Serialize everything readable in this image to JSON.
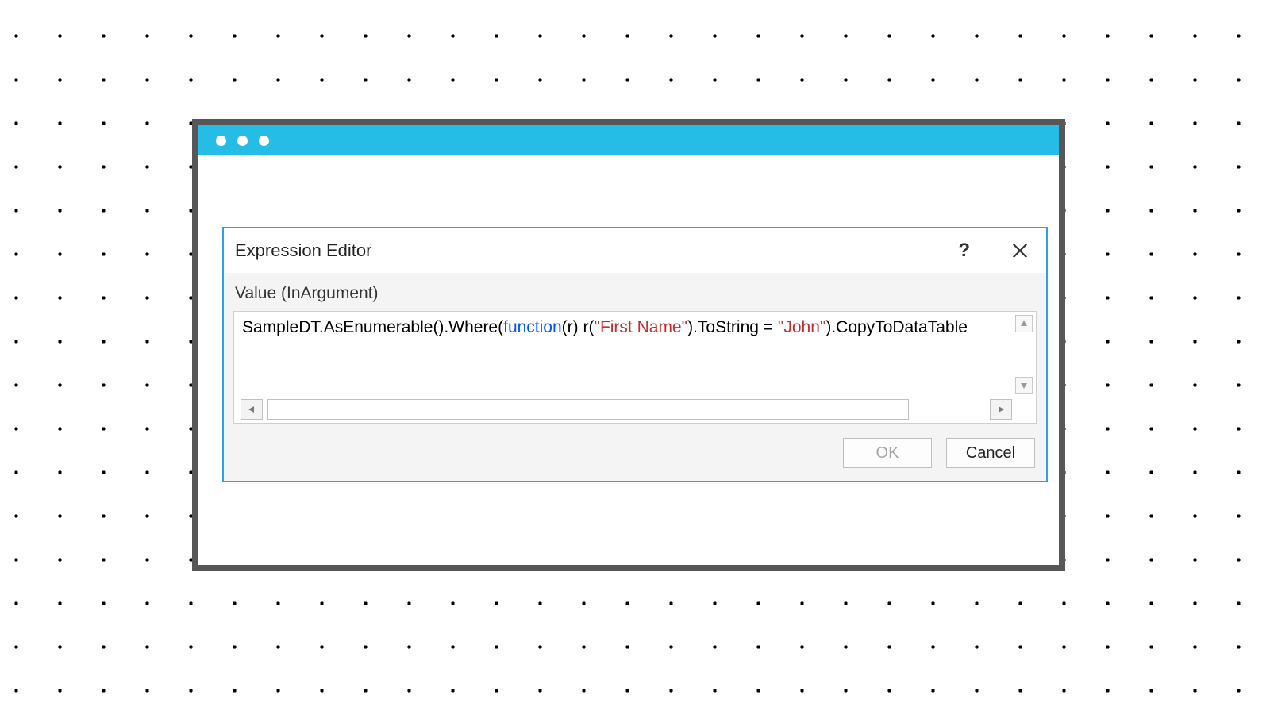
{
  "dialog": {
    "title": "Expression Editor",
    "subheader": "Value (InArgument)",
    "ok_label": "OK",
    "cancel_label": "Cancel"
  },
  "expression": {
    "seg1": "SampleDT.AsEnumerable().Where(",
    "keyword": "function",
    "seg2": "(r) r(",
    "string1": "\"First Name\"",
    "seg3": ").ToString = ",
    "string2": "\"John\"",
    "seg4": ").CopyToDataTable"
  }
}
